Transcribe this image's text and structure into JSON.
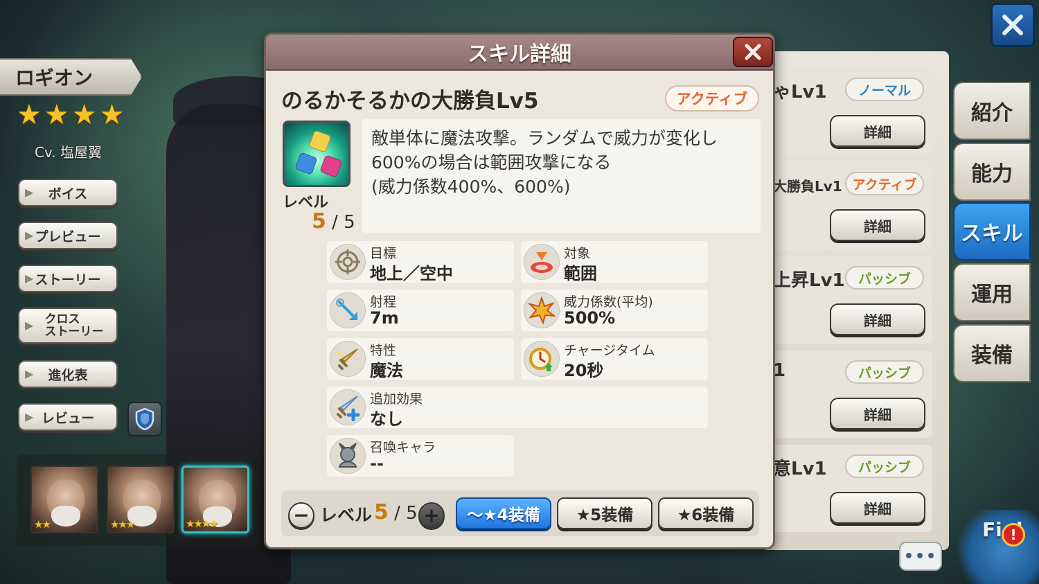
{
  "character": {
    "name": "ロギオン",
    "star_count": 4,
    "cv": "Cv. 塩屋翼"
  },
  "side_menu": [
    {
      "label": "ボイス"
    },
    {
      "label": "プレビュー"
    },
    {
      "label": "ストーリー"
    },
    {
      "label": "クロス\nストーリー"
    },
    {
      "label": "進化表"
    },
    {
      "label": "レビュー"
    }
  ],
  "portraits": [
    {
      "stars": "★★",
      "selected": false
    },
    {
      "stars": "★★★",
      "selected": false
    },
    {
      "stars": "★★★★",
      "selected": true
    }
  ],
  "right_tabs": [
    {
      "label": "紹介",
      "active": false
    },
    {
      "label": "能力",
      "active": false
    },
    {
      "label": "スキル",
      "active": true
    },
    {
      "label": "運用",
      "active": false
    },
    {
      "label": "装備",
      "active": false
    }
  ],
  "skill_list": [
    {
      "name_fragment": "ゃLv1",
      "type": "ノーマル",
      "type_color": "#2e7fc4",
      "detail": "詳細"
    },
    {
      "name_fragment": "大勝負Lv1",
      "type": "アクティブ",
      "type_color": "#e36a2a",
      "detail": "詳細"
    },
    {
      "name_fragment": "上昇Lv1",
      "type": "パッシブ",
      "type_color": "#6e9a2a",
      "detail": "詳細"
    },
    {
      "name_fragment": "1",
      "type": "パッシブ",
      "type_color": "#6e9a2a",
      "detail": "詳細"
    },
    {
      "name_fragment": "意Lv1",
      "type": "パッシブ",
      "type_color": "#6e9a2a",
      "detail": "詳細"
    }
  ],
  "modal": {
    "title": "スキル詳細",
    "skill_name": "のるかそるかの大勝負Lv5",
    "skill_type": "アクティブ",
    "level_label": "レベル",
    "level_current": "5",
    "level_max": "/ 5",
    "description_lines": [
      "敵単体に魔法攻撃。ランダムで威力が変化し",
      "600%の場合は範囲攻撃になる",
      "(威力係数400%、600%)"
    ],
    "stats": [
      {
        "label": "目標",
        "value": "地上／空中",
        "icon": "crosshair-icon"
      },
      {
        "label": "対象",
        "value": "範囲",
        "icon": "area-target-icon"
      },
      {
        "label": "射程",
        "value": "7m",
        "icon": "range-arrow-icon"
      },
      {
        "label": "威力係数(平均)",
        "value": "500%",
        "icon": "explosion-icon"
      },
      {
        "label": "特性",
        "value": "魔法",
        "icon": "magic-sword-icon"
      },
      {
        "label": "チャージタイム",
        "value": "20秒",
        "icon": "clock-charge-icon"
      },
      {
        "label": "追加効果",
        "value": "なし",
        "icon": "sword-plus-icon"
      },
      {
        "label": "召喚キャラ",
        "value": "--",
        "icon": "summon-icon"
      }
    ],
    "bottom_bar": {
      "minus": "−",
      "plus": "+",
      "level_label": "レベル",
      "level_current": "5",
      "level_max": "/ 5",
      "equip_buttons": [
        {
          "label": "〜★4装備",
          "active": true
        },
        {
          "label": "★5装備",
          "active": false
        },
        {
          "label": "★6装備",
          "active": false
        }
      ]
    }
  },
  "chat_label": "•••",
  "mascot_label": "Fi d",
  "alert_label": "!",
  "colors": {
    "modal_header": "#8a6c6d",
    "active_tab": "#1c6bc2",
    "active_type": "#e36a2a",
    "level_highlight": "#c47b15"
  }
}
